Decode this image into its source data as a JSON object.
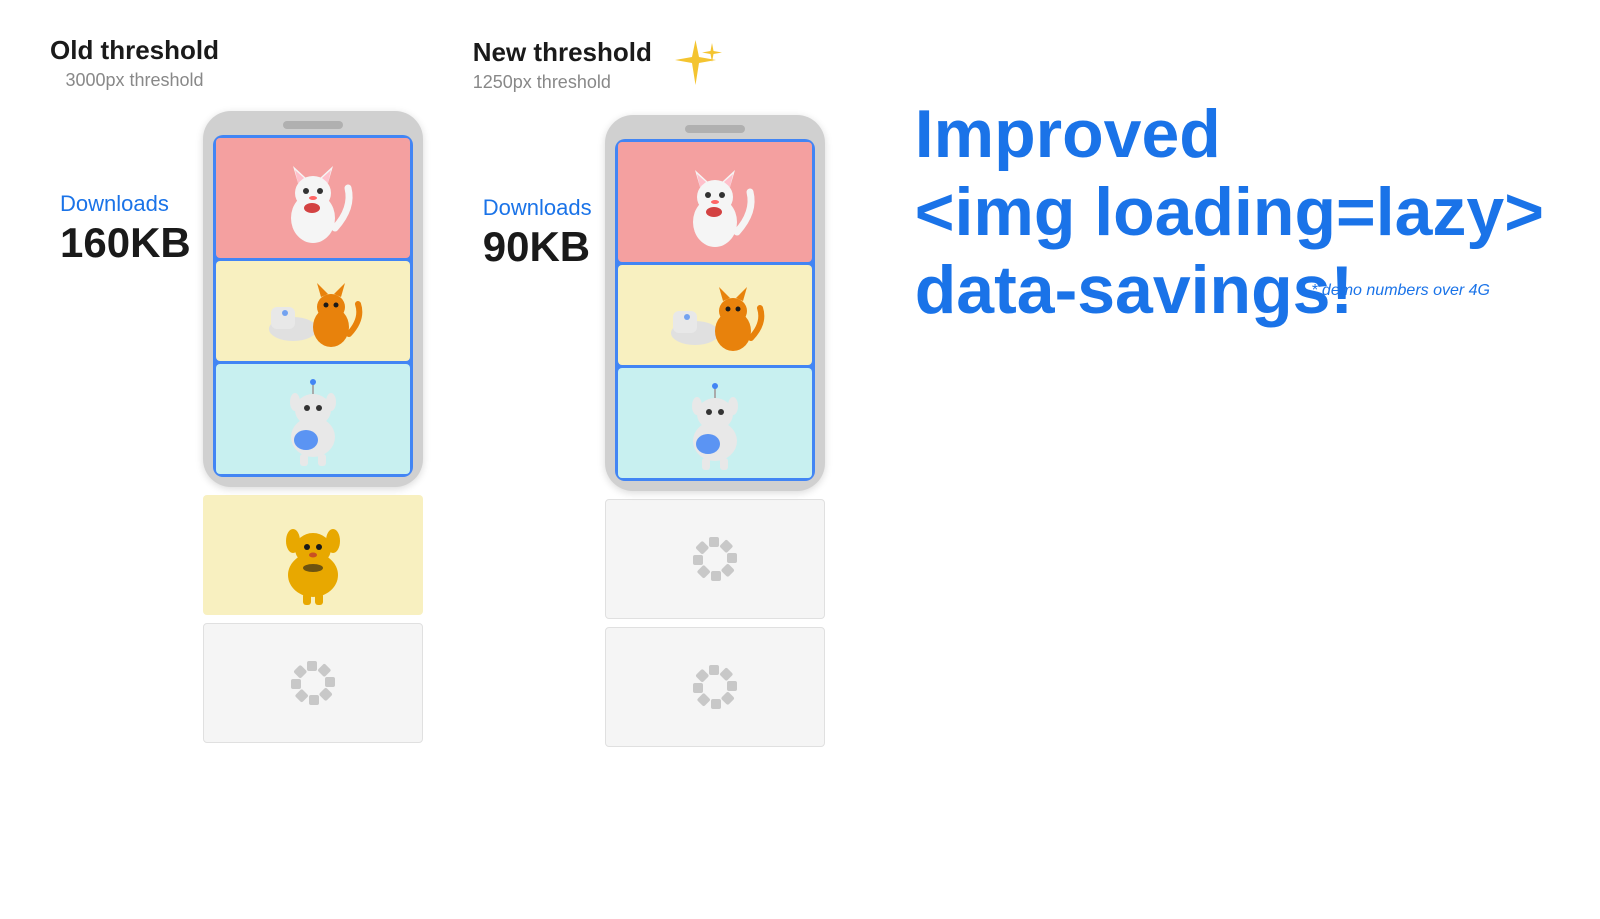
{
  "old_threshold": {
    "title": "Old threshold",
    "subtitle": "3000px threshold",
    "downloads_label": "Downloads",
    "downloads_size": "160KB"
  },
  "new_threshold": {
    "title": "New threshold",
    "subtitle": "1250px threshold",
    "downloads_label": "Downloads",
    "downloads_size": "90KB"
  },
  "headline": {
    "line1": "Improved",
    "line2": "<img loading=lazy>",
    "line3": "data-savings!"
  },
  "demo_note": "* demo numbers over 4G",
  "sparkle_icon": "✦",
  "loading_icon": "⊹"
}
